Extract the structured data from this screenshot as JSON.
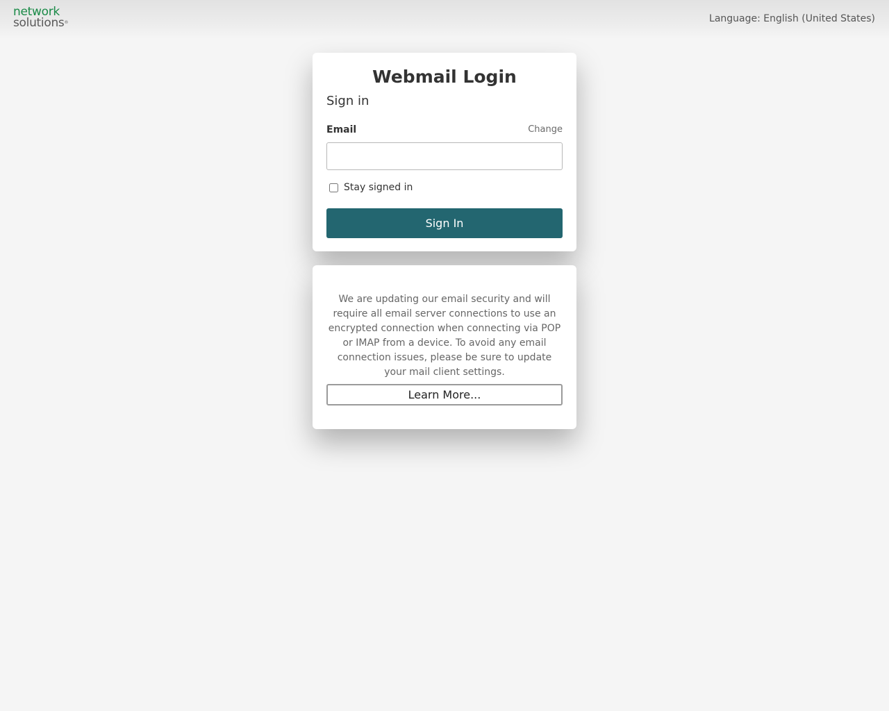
{
  "header": {
    "logo_line1": "network",
    "logo_line2": "solutions",
    "logo_mark": "®",
    "language_label": "Language: English (United States)"
  },
  "login": {
    "title": "Webmail Login",
    "subtitle": "Sign in",
    "email_label": "Email",
    "change_link": "Change",
    "email_value": "",
    "email_placeholder": "",
    "stay_signed_in_label": "Stay signed in",
    "stay_signed_in_checked": false,
    "sign_in_button": "Sign In"
  },
  "info": {
    "notice": "We are updating our email security and will require all email server connections to use an encrypted connection when connecting via POP or IMAP from a device. To avoid any email connection issues, please be sure to update your mail client settings.",
    "learn_more_button": "Learn More..."
  },
  "colors": {
    "brand_green": "#1a8a47",
    "primary_button": "#236670",
    "background": "#f5f5f5"
  }
}
